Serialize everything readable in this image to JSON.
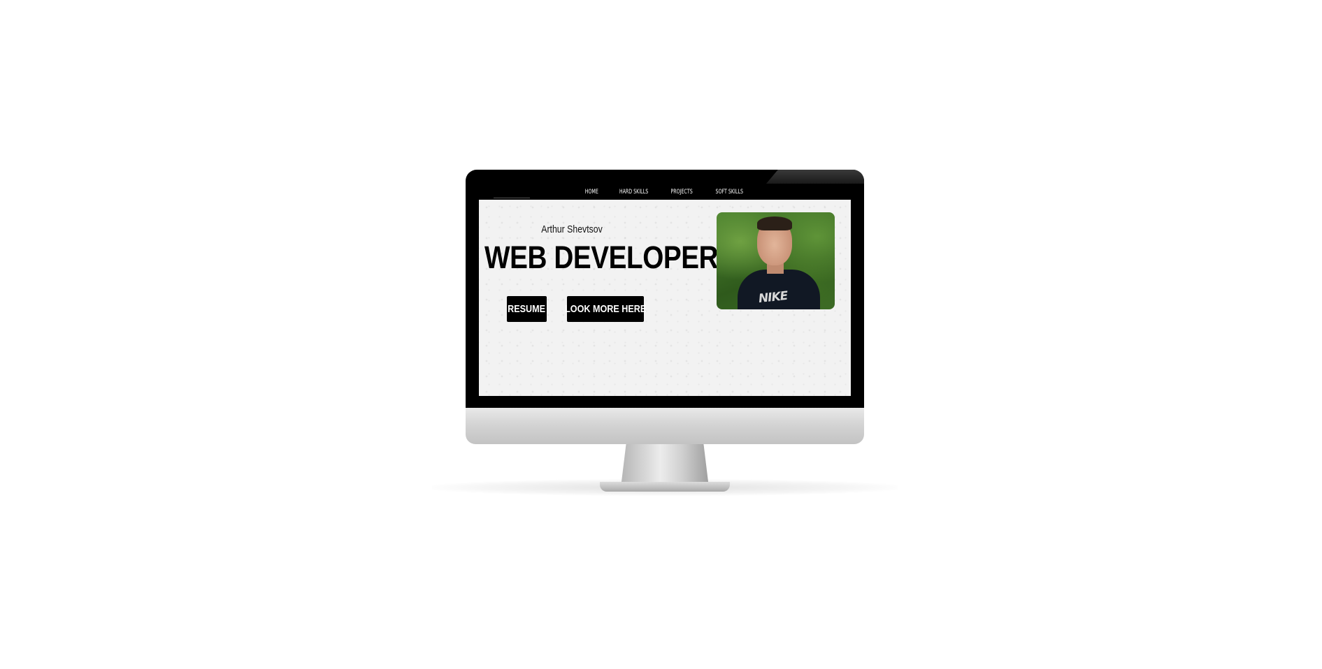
{
  "nav": {
    "items": [
      {
        "label": "HOME"
      },
      {
        "label": "HARD SKILLS"
      },
      {
        "label": "PROJECTS"
      },
      {
        "label": "SOFT SKILLS"
      }
    ]
  },
  "hero": {
    "name": "Arthur Shevtsov",
    "title": "WEB DEVELOPER",
    "buttons": {
      "resume": "RESUME",
      "look_more": "LOOK MORE HERE"
    },
    "photo_shirt_text": "NIKE"
  },
  "colors": {
    "nav_bg": "#000000",
    "button_bg": "#000000",
    "button_text": "#ffffff",
    "page_bg": "#f2f2f2"
  }
}
